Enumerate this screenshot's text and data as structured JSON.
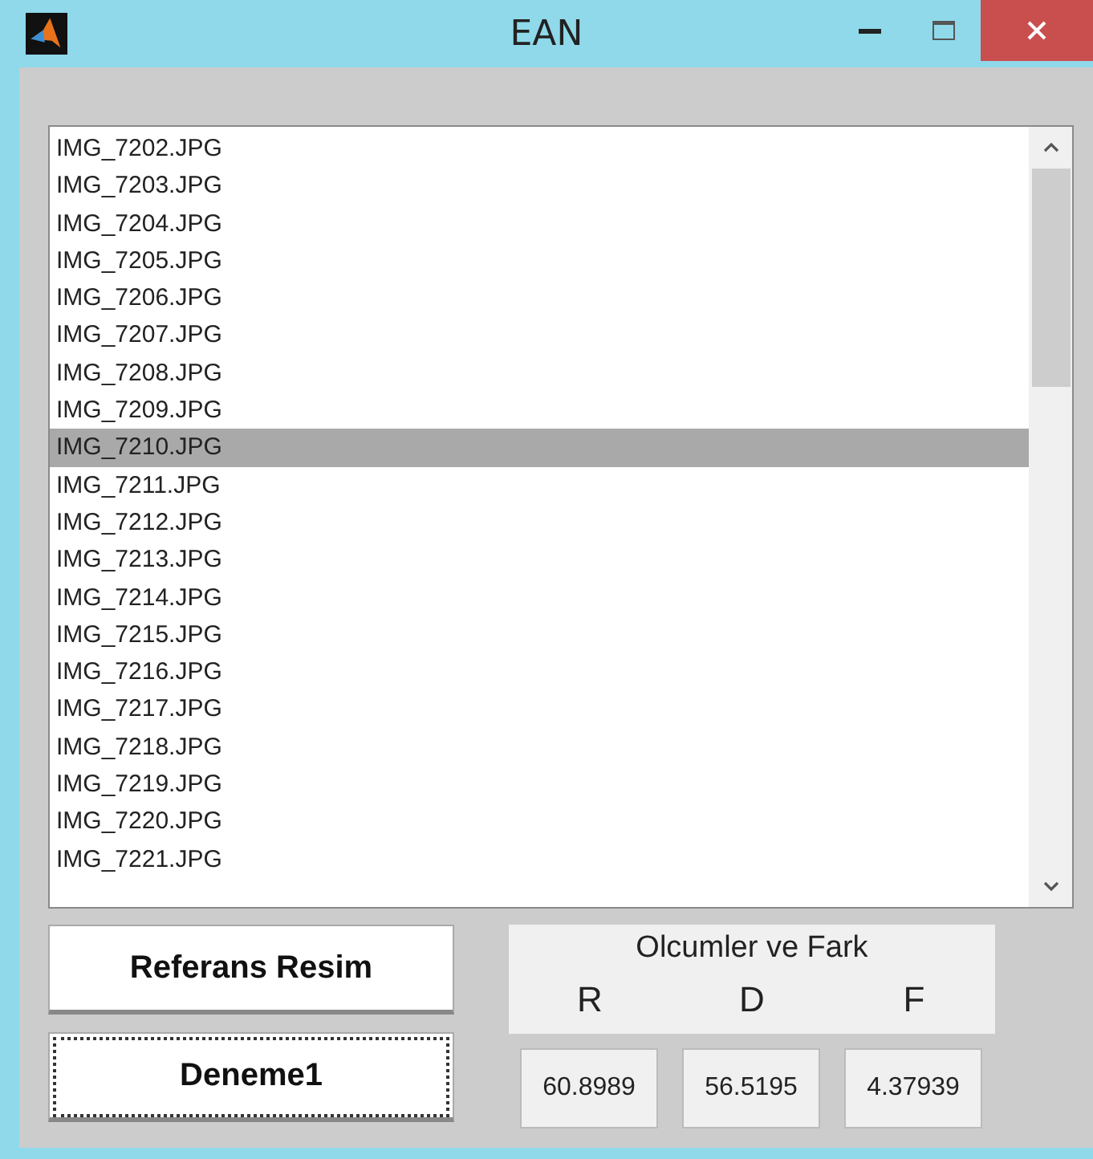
{
  "window": {
    "title": "EAN"
  },
  "files": [
    {
      "name": "IMG_7202.JPG",
      "selected": false
    },
    {
      "name": "IMG_7203.JPG",
      "selected": false
    },
    {
      "name": "IMG_7204.JPG",
      "selected": false
    },
    {
      "name": "IMG_7205.JPG",
      "selected": false
    },
    {
      "name": "IMG_7206.JPG",
      "selected": false
    },
    {
      "name": "IMG_7207.JPG",
      "selected": false
    },
    {
      "name": "IMG_7208.JPG",
      "selected": false
    },
    {
      "name": "IMG_7209.JPG",
      "selected": false
    },
    {
      "name": "IMG_7210.JPG",
      "selected": true
    },
    {
      "name": "IMG_7211.JPG",
      "selected": false
    },
    {
      "name": "IMG_7212.JPG",
      "selected": false
    },
    {
      "name": "IMG_7213.JPG",
      "selected": false
    },
    {
      "name": "IMG_7214.JPG",
      "selected": false
    },
    {
      "name": "IMG_7215.JPG",
      "selected": false
    },
    {
      "name": "IMG_7216.JPG",
      "selected": false
    },
    {
      "name": "IMG_7217.JPG",
      "selected": false
    },
    {
      "name": "IMG_7218.JPG",
      "selected": false
    },
    {
      "name": "IMG_7219.JPG",
      "selected": false
    },
    {
      "name": "IMG_7220.JPG",
      "selected": false
    },
    {
      "name": "IMG_7221.JPG",
      "selected": false
    }
  ],
  "buttons": [
    {
      "label": "Referans Resim",
      "focused": false
    },
    {
      "label": "Deneme1",
      "focused": true
    }
  ],
  "measurements": {
    "title": "Olcumler ve Fark",
    "columns": [
      "R",
      "D",
      "F"
    ],
    "values": [
      "60.8989",
      "56.5195",
      "4.37939"
    ]
  }
}
